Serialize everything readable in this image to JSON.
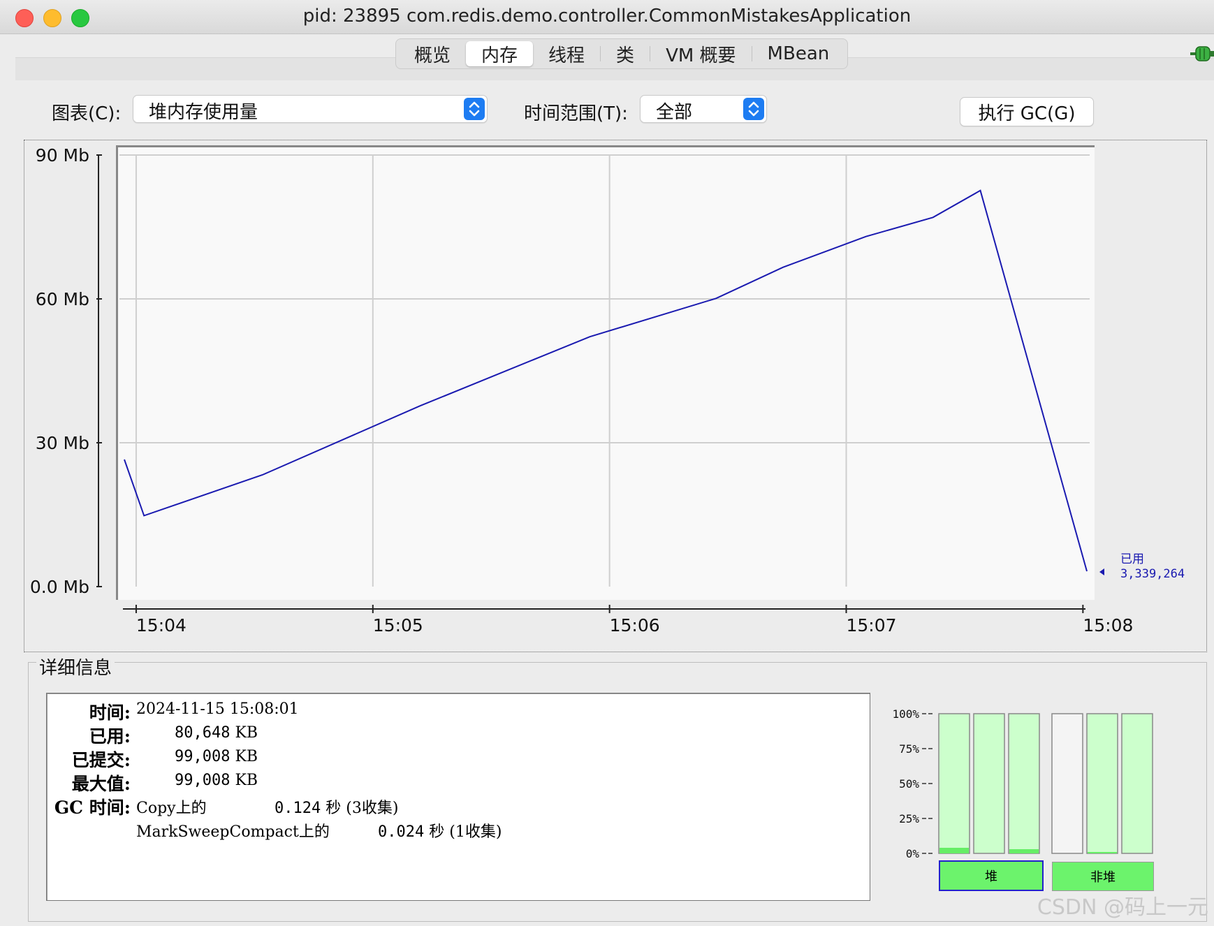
{
  "window": {
    "title": "pid: 23895 com.redis.demo.controller.CommonMistakesApplication"
  },
  "tabs": [
    {
      "label": "概览",
      "active": false
    },
    {
      "label": "内存",
      "active": true
    },
    {
      "label": "线程",
      "active": false
    },
    {
      "label": "类",
      "active": false
    },
    {
      "label": "VM 概要",
      "active": false
    },
    {
      "label": "MBean",
      "active": false
    }
  ],
  "toolbar": {
    "chart_label": "图表(C):",
    "chart_value": "堆内存使用量",
    "range_label": "时间范围(T):",
    "range_value": "全部",
    "gc_button": "执行 GC(G)"
  },
  "chart_data": {
    "type": "line",
    "y_tick_labels": [
      "90 Mb",
      "60 Mb",
      "30 Mb",
      "0.0 Mb"
    ],
    "y_ticks_mb": [
      90,
      60,
      30,
      0
    ],
    "ylim": [
      0,
      90
    ],
    "x_tick_labels": [
      "15:04",
      "15:05",
      "15:06",
      "15:07",
      "15:08"
    ],
    "xlim": [
      "15:03:57",
      "15:08:01"
    ],
    "line_color": "#1a1ab0",
    "series": [
      {
        "name": "已用",
        "x": [
          "15:03:57",
          "15:04:02",
          "15:04:32",
          "15:05:12",
          "15:05:55",
          "15:06:27",
          "15:06:44",
          "15:07:05",
          "15:07:22",
          "15:07:34",
          "15:08:01"
        ],
        "y_mb": [
          26.5,
          14.8,
          23.3,
          37.7,
          52.1,
          60.1,
          66.6,
          73.0,
          77.0,
          82.6,
          3.2
        ]
      }
    ],
    "current_label": "已用",
    "current_value": "3,339,264"
  },
  "details": {
    "section_title": "详细信息",
    "time_key": "时间:",
    "time_value": "2024-11-15 15:08:01",
    "used_key": "已用:",
    "used_value": "80,648",
    "committed_key": "已提交:",
    "committed_value": "99,008",
    "max_key": "最大值:",
    "max_value": "99,008",
    "unit": "KB",
    "gc_key": "GC 时间:",
    "gc_rows": [
      {
        "collector": "Copy上的",
        "time": "0.124",
        "unit": "秒",
        "count": "(3收集)"
      },
      {
        "collector": "MarkSweepCompact上的",
        "time": "0.024",
        "unit": "秒",
        "count": "(1收集)"
      }
    ]
  },
  "pools": {
    "scale": [
      "100%",
      "75%",
      "50%",
      "25%",
      "0%"
    ],
    "heap_fill": [
      0.04,
      0.0,
      0.03
    ],
    "nonheap_fill": [
      0.0,
      0.01,
      0.0
    ],
    "heap_label": "堆",
    "nonheap_label": "非堆",
    "bar_color": "#ccffcc",
    "fill_color": "#66ee66"
  },
  "watermark": "CSDN @码上一元"
}
